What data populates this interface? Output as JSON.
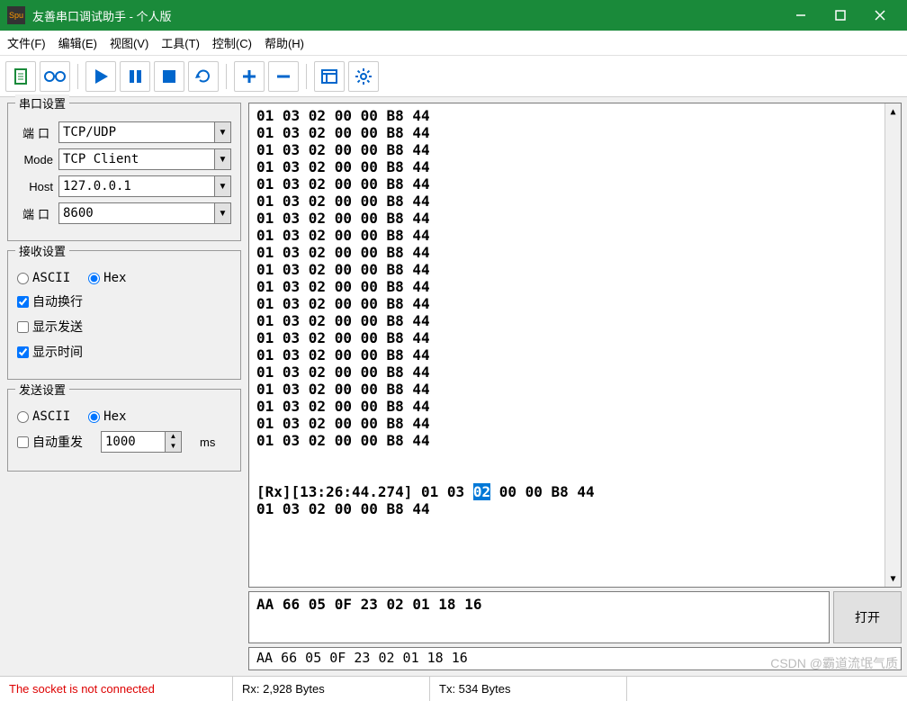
{
  "window": {
    "title": "友善串口调试助手 - 个人版",
    "icon_text": "Spu"
  },
  "menu": {
    "file": "文件(F)",
    "edit": "编辑(E)",
    "view": "视图(V)",
    "tools": "工具(T)",
    "control": "控制(C)",
    "help": "帮助(H)"
  },
  "serial_settings": {
    "legend": "串口设置",
    "port_label": "端口",
    "port_value": "TCP/UDP",
    "mode_label": "Mode",
    "mode_value": "TCP Client",
    "host_label": "Host",
    "host_value": "127.0.0.1",
    "port2_label": "端口",
    "port2_value": "8600"
  },
  "recv_settings": {
    "legend": "接收设置",
    "ascii": "ASCII",
    "hex": "Hex",
    "auto_wrap": "自动换行",
    "show_send": "显示发送",
    "show_time": "显示时间"
  },
  "send_settings": {
    "legend": "发送设置",
    "ascii": "ASCII",
    "hex": "Hex",
    "auto_resend": "自动重发",
    "interval": "1000",
    "unit": "ms"
  },
  "rx_data": {
    "line": "01 03 02 00 00 B8 44",
    "repeat": 20,
    "timestamp_prefix": "[Rx][13:26:44.274] 01 03 ",
    "highlighted": "02",
    "timestamp_suffix": " 00 00 B8 44",
    "last_line": "01 03 02 00 00 B8 44"
  },
  "tx_data": {
    "value": "AA 66 05 0F 23 02 01 18 16",
    "value2": "AA 66 05 0F 23 02 01 18 16"
  },
  "open_button": "打开",
  "status": {
    "error": "The socket is not connected",
    "rx": "Rx: 2,928 Bytes",
    "tx": "Tx: 534 Bytes"
  },
  "watermark": "CSDN @霸道流氓气质"
}
